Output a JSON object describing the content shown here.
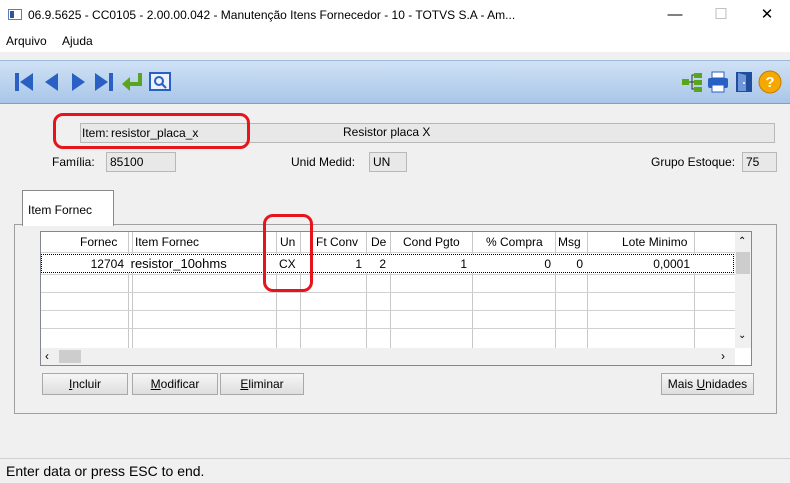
{
  "window": {
    "title": "06.9.5625 - CC0105 - 2.00.00.042 - Manutenção Itens Fornecedor - 10 - TOTVS S.A - Am...",
    "minimize_icon": "minimize-icon",
    "maximize_icon": "maximize-icon",
    "close_icon": "close-icon"
  },
  "menu": {
    "arquivo": "Arquivo",
    "ajuda": "Ajuda"
  },
  "toolbar": {
    "left_icons": [
      "first-record-icon",
      "previous-record-icon",
      "next-record-icon",
      "last-record-icon",
      "goto-icon",
      "search-icon"
    ],
    "right_icons": [
      "tree-icon",
      "print-icon",
      "exit-door-icon",
      "help-icon"
    ]
  },
  "form": {
    "item_label": "Item:",
    "item_value": "resistor_placa_x",
    "item_desc": "Resistor placa X",
    "familia_label": "Família:",
    "familia_value": "85100",
    "unid_label": "Unid Medid:",
    "unid_value": "UN",
    "grupo_label": "Grupo Estoque:",
    "grupo_value": "75"
  },
  "tab": {
    "label": "Item Fornec"
  },
  "grid": {
    "headers": [
      "Fornec",
      "Item Fornec",
      "Un",
      "Ft Conv",
      "De",
      "Cond Pgto",
      "% Compra",
      "Msg",
      "Lote Minimo"
    ],
    "rows": [
      [
        "12704",
        "resistor_10ohms",
        "CX",
        "1",
        "2",
        "1",
        "0",
        "0",
        "0,0001"
      ]
    ]
  },
  "buttons": {
    "incluir_u": "I",
    "incluir_rest": "ncluir",
    "modificar_u": "M",
    "modificar_rest": "odificar",
    "eliminar_u": "E",
    "eliminar_rest": "liminar",
    "mais_a": "Mais ",
    "mais_u": "U",
    "mais_b": "nidades"
  },
  "status": {
    "text": "Enter data or press ESC to end."
  },
  "colors": {
    "highlight": "#e8141b",
    "toolbar": "#b9d1ee"
  }
}
